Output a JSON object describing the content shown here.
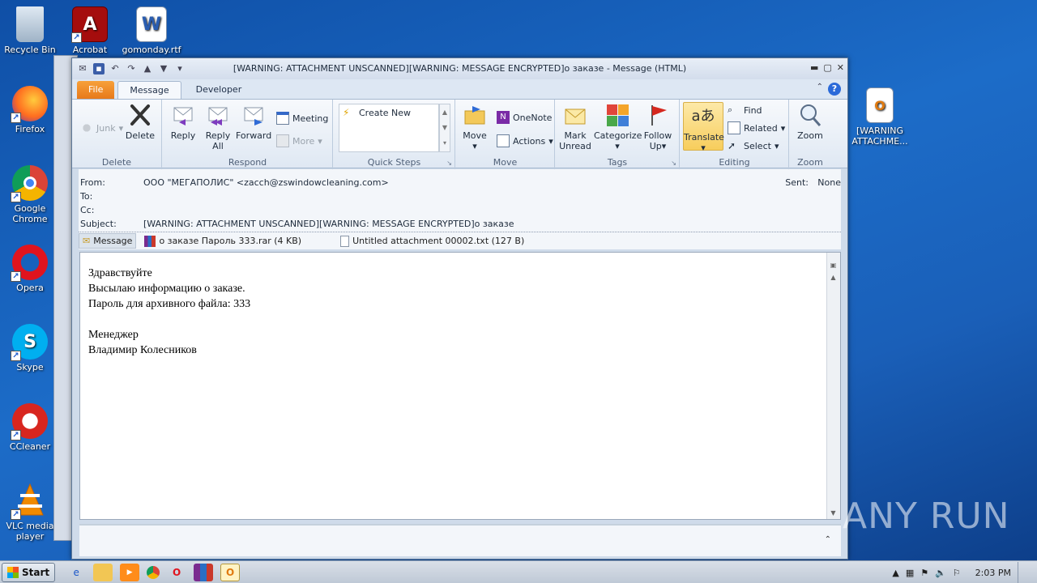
{
  "desktop": {
    "icons": [
      {
        "label": "Recycle Bin",
        "icon": "recycle-bin-icon"
      },
      {
        "label": "Acrobat",
        "icon": "acrobat-icon"
      },
      {
        "label": "gomonday.rtf",
        "icon": "word-doc-icon"
      },
      {
        "label": "Firefox",
        "icon": "firefox-icon"
      },
      {
        "label": "Google Chrome",
        "icon": "chrome-icon"
      },
      {
        "label": "Opera",
        "icon": "opera-icon"
      },
      {
        "label": "Skype",
        "icon": "skype-icon"
      },
      {
        "label": "CCleaner",
        "icon": "ccleaner-icon"
      },
      {
        "label": "VLC media player",
        "icon": "vlc-icon"
      },
      {
        "label": "[WARNING ATTACHME...",
        "icon": "outlook-msg-icon"
      }
    ],
    "watermark": "ANY RUN"
  },
  "window": {
    "title": "[WARNING: ATTACHMENT UNSCANNED][WARNING: MESSAGE ENCRYPTED]о заказе  -  Message (HTML)",
    "tabs": [
      "File",
      "Message",
      "Developer"
    ],
    "active_tab": "Message"
  },
  "ribbon": {
    "delete": {
      "label": "Delete",
      "junk": "Junk",
      "delete": "Delete"
    },
    "respond": {
      "label": "Respond",
      "reply": "Reply",
      "reply_all": "Reply All",
      "forward": "Forward",
      "meeting": "Meeting",
      "more": "More"
    },
    "quicksteps": {
      "label": "Quick Steps",
      "create_new": "Create New"
    },
    "move": {
      "label": "Move",
      "move": "Move",
      "onenote": "OneNote",
      "actions": "Actions"
    },
    "tags": {
      "label": "Tags",
      "mark_unread": "Mark Unread",
      "categorize": "Categorize",
      "follow_up": "Follow Up"
    },
    "editing": {
      "label": "Editing",
      "translate": "Translate",
      "find": "Find",
      "related": "Related",
      "select": "Select"
    },
    "zoom": {
      "label": "Zoom",
      "zoom": "Zoom"
    }
  },
  "header": {
    "from_label": "From:",
    "from_value": "ООО \"МЕГАПОЛИС\" <zacch@zswindowcleaning.com>",
    "to_label": "To:",
    "cc_label": "Cc:",
    "subject_label": "Subject:",
    "subject_value": "[WARNING: ATTACHMENT UNSCANNED][WARNING: MESSAGE ENCRYPTED]о заказе",
    "sent_label": "Sent:",
    "sent_value": "None"
  },
  "attachments": {
    "message": "Message",
    "att1": "о заказе Пароль 333.rar (4 KB)",
    "att2": "Untitled attachment 00002.txt (127 B)"
  },
  "body": {
    "lines": [
      "Здравствуйте",
      "Высылаю информацию о заказе.",
      "Пароль для архивного файла: 333",
      "",
      "Менеджер",
      "Владимир Колесников"
    ]
  },
  "taskbar": {
    "start": "Start",
    "time": "2:03 PM"
  }
}
